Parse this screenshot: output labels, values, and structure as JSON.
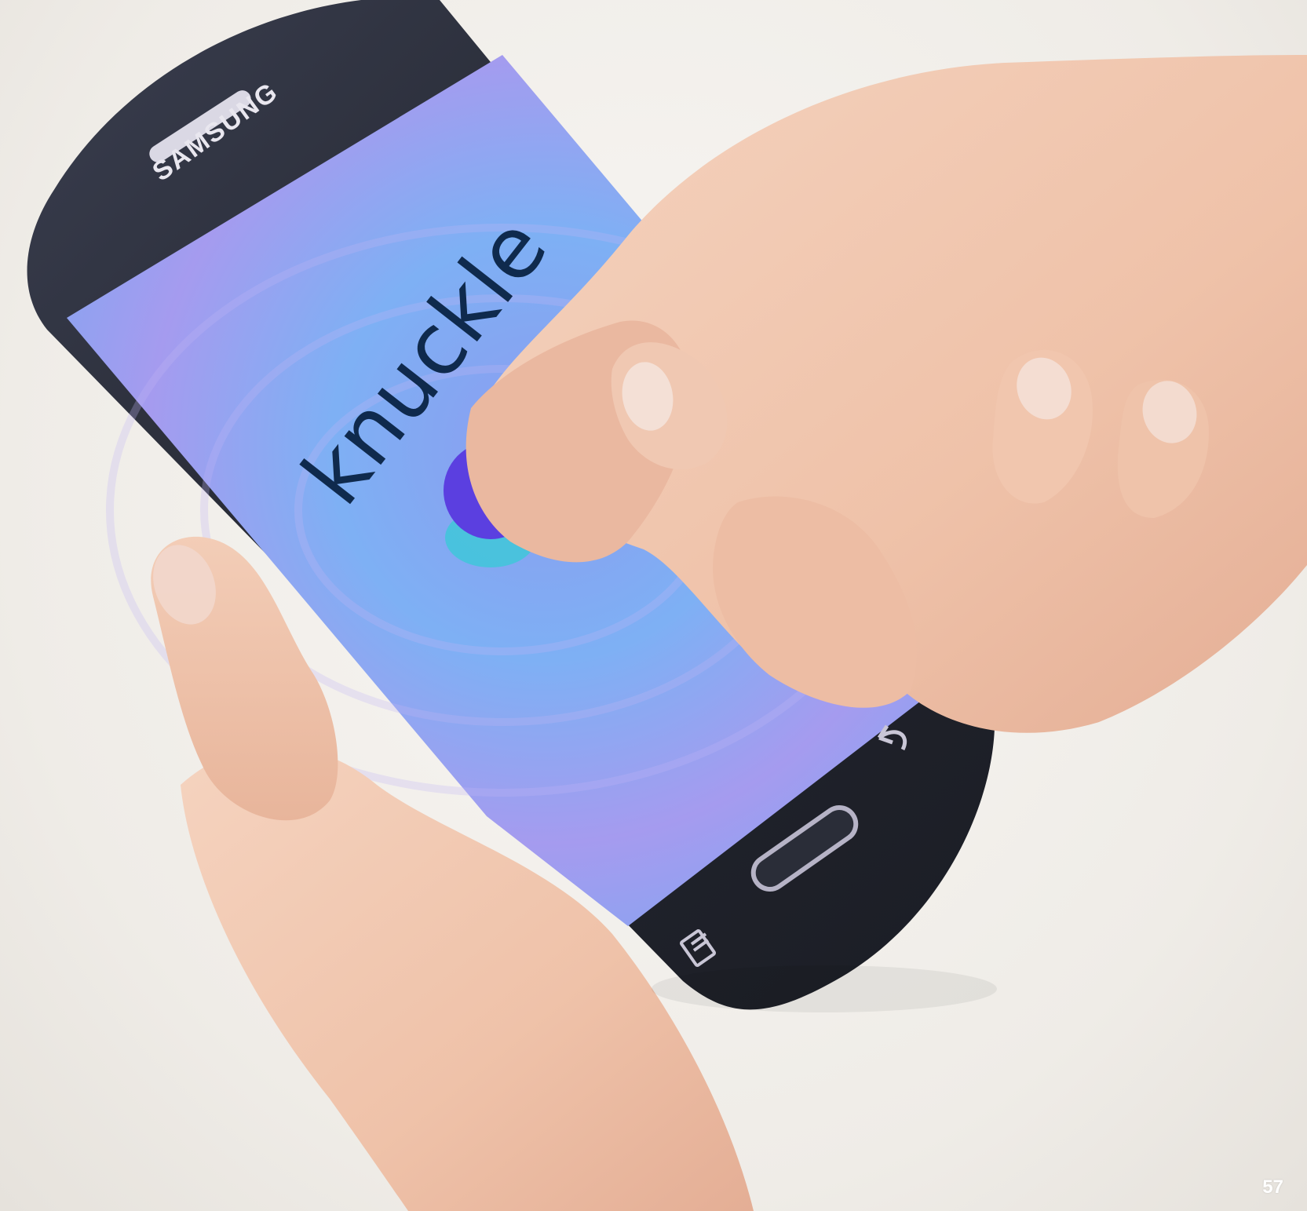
{
  "photo": {
    "screen_word": "knuckle",
    "brand": "SAMSUNG",
    "page_number": "57",
    "colors": {
      "background": "#f3f1ee",
      "phone_body": "#2b2e3b",
      "screen_blue": "#7fa8f2",
      "screen_purple": "#a89af0",
      "touch_circle": "#5b3fe0",
      "touch_shadow": "#3fc7d9",
      "skin": "#f0c5ae"
    },
    "icons": [
      "back-icon",
      "menu-icon",
      "home-button"
    ]
  }
}
